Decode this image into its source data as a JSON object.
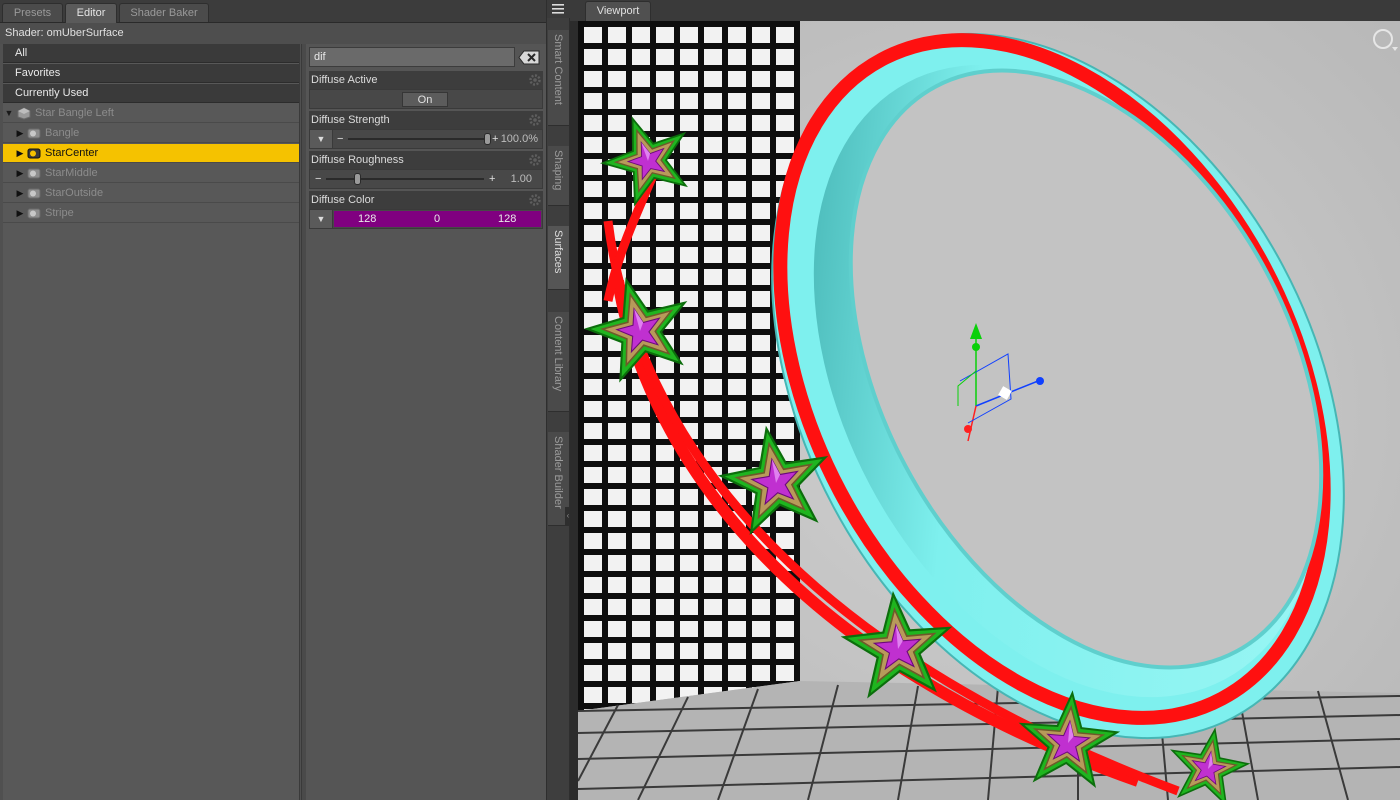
{
  "tabs": [
    {
      "label": "Presets",
      "active": false
    },
    {
      "label": "Editor",
      "active": true
    },
    {
      "label": "Shader Baker",
      "active": false
    }
  ],
  "shader": {
    "label": "Shader: omUberSurface"
  },
  "filters": [
    {
      "label": "All"
    },
    {
      "label": "Favorites"
    },
    {
      "label": "Currently Used"
    }
  ],
  "tree": {
    "root": "Star Bangle Left",
    "children": [
      {
        "label": "Bangle",
        "selected": false
      },
      {
        "label": "StarCenter",
        "selected": true
      },
      {
        "label": "StarMiddle",
        "selected": false
      },
      {
        "label": "StarOutside",
        "selected": false
      },
      {
        "label": "Stripe",
        "selected": false
      }
    ]
  },
  "search": {
    "value": "dif"
  },
  "properties": {
    "diffuse_active": {
      "label": "Diffuse Active",
      "value": "On"
    },
    "diffuse_strength": {
      "label": "Diffuse Strength",
      "value": "100.0%",
      "fraction": 1.0
    },
    "diffuse_roughness": {
      "label": "Diffuse Roughness",
      "value": "1.00",
      "fraction": 0.0
    },
    "diffuse_color": {
      "label": "Diffuse Color",
      "r": "128",
      "g": "0",
      "b": "128",
      "swatch": "#800080"
    }
  },
  "side_tabs": [
    {
      "label": "Smart Content",
      "active": false
    },
    {
      "label": "Shaping",
      "active": false
    },
    {
      "label": "Surfaces",
      "active": true
    },
    {
      "label": "Content Library",
      "active": false
    },
    {
      "label": "Shader Builder",
      "active": false
    }
  ],
  "viewport": {
    "label": "Viewport"
  },
  "colors": {
    "selection": "#f5c200",
    "bangle_body": "#7ef0ee",
    "bangle_stripe": "#ff0000",
    "star_outer": "#2fbf2f",
    "star_middle": "#b89a5a",
    "star_center": "#b030c0"
  },
  "icons": {
    "tree_expand": "triangle-right-icon",
    "tree_collapse": "triangle-down-icon",
    "figure": "figure-icon",
    "surface": "surface-icon",
    "clear_search": "clear-search-icon",
    "gear": "gear-icon",
    "menu": "menu-icon",
    "camera": "camera-icon"
  }
}
